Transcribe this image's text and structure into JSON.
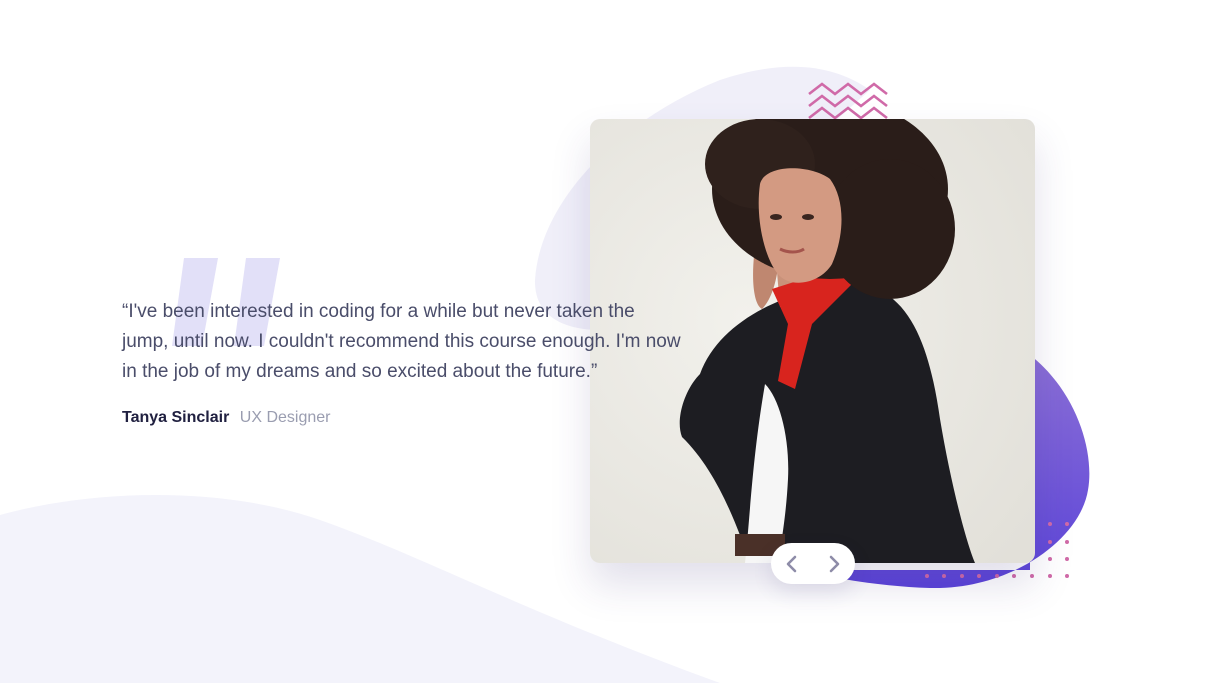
{
  "testimonial": {
    "quote": "“I've been interested in coding for a while but never taken the jump, until now. I couldn't recommend this course enough. I'm now in the job of my dreams and so excited about the future.”",
    "author_name": "Tanya Sinclair",
    "author_role": "UX Designer"
  },
  "navigation": {
    "prev_icon": "chevron-left-icon",
    "next_icon": "chevron-right-icon"
  },
  "colors": {
    "background": "#ffffff",
    "curve": "#f3f3fb",
    "quote_mark": "#e2e0f8",
    "text": "#4a4d6a",
    "name": "#202040",
    "role": "#9a9db0",
    "accent_start": "#8b6fd6",
    "accent_end": "#5b44d9",
    "zigzag": "#d06aa8",
    "chevron": "#8e8ca8"
  }
}
